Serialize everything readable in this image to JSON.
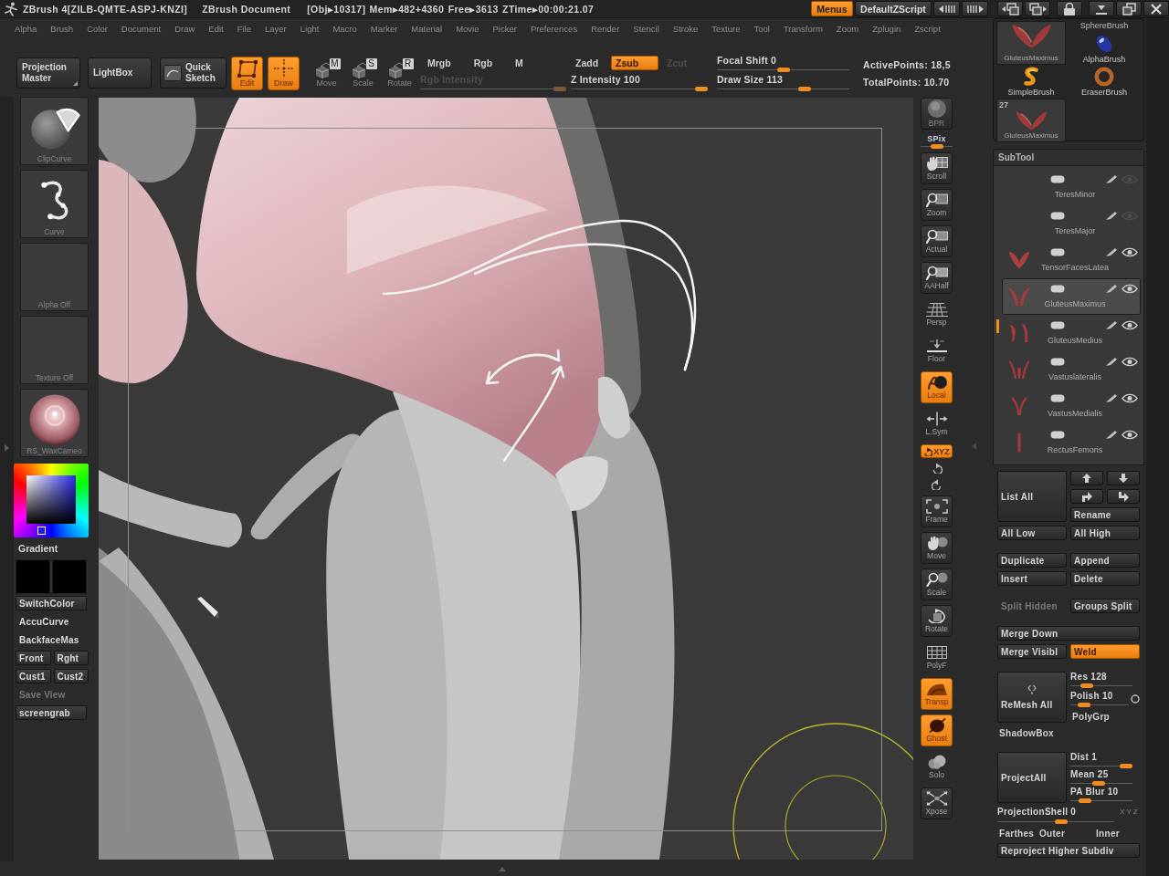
{
  "title_bar": {
    "app_title": "ZBrush 4[ZILB-QMTE-ASPJ-KNZI]",
    "document_title": "ZBrush Document",
    "stats": "[Obj▸10317] Mem▸482+4360 Free▸3613 ZTime▸00:00:21.07",
    "buttons": [
      {
        "label": "Menus",
        "on": true
      },
      {
        "label": "DefaultZScript",
        "on": false
      }
    ]
  },
  "menu_bar": [
    "Alpha",
    "Brush",
    "Color",
    "Document",
    "Draw",
    "Edit",
    "File",
    "Layer",
    "Light",
    "Macro",
    "Marker",
    "Material",
    "Movie",
    "Picker",
    "Preferences",
    "Render",
    "Stencil",
    "Stroke",
    "Texture",
    "Tool",
    "Transform",
    "Zoom",
    "Zplugin",
    "Zscript"
  ],
  "top_shelf": {
    "buttons": [
      {
        "label": "Projection Master"
      },
      {
        "label": "LightBox"
      },
      {
        "label": "Quick Sketch"
      }
    ],
    "modes": [
      {
        "label": "Edit",
        "on": true
      },
      {
        "label": "Draw",
        "on": true
      },
      {
        "label": "Move",
        "key": "M",
        "on": false
      },
      {
        "label": "Scale",
        "key": "S",
        "on": false
      },
      {
        "label": "Rotate",
        "key": "R",
        "on": false
      }
    ],
    "channels": [
      {
        "label": "Mrgb",
        "on": false
      },
      {
        "label": "Rgb",
        "on": false
      },
      {
        "label": "M",
        "on": false
      }
    ],
    "rgb_intensity": {
      "label": "Rgb Intensity",
      "disabled": true,
      "level": 1
    },
    "z_modes": [
      {
        "label": "Zadd",
        "on": false,
        "disabled": false
      },
      {
        "label": "Zsub",
        "on": true,
        "disabled": false
      },
      {
        "label": "Zcut",
        "on": false,
        "disabled": true
      }
    ],
    "z_intensity": {
      "label": "Z Intensity 100",
      "level": 1
    },
    "focal_shift": {
      "label": "Focal Shift 0",
      "level": 0.5
    },
    "draw_size": {
      "label": "Draw Size 113",
      "level": 0.68
    },
    "active_points": "ActivePoints: 18,5",
    "total_points": "TotalPoints: 10.70"
  },
  "left_shelf": {
    "slots": [
      {
        "label": "ClipCurve"
      },
      {
        "label": "Curve"
      },
      {
        "label": "Alpha Off"
      },
      {
        "label": "Texture Off"
      },
      {
        "label": "RS_WaxCameo"
      }
    ],
    "gradient_label": "Gradient",
    "swatches": [
      {
        "color": "#000000"
      },
      {
        "color": "#000000"
      }
    ],
    "controls": [
      [
        {
          "label": "SwitchColor",
          "kind": "button",
          "on": false,
          "disabled": false
        }
      ],
      [
        {
          "label": "AccuCurve",
          "kind": "switch",
          "on": false,
          "disabled": false
        }
      ],
      [
        {
          "label": "BackfaceMas",
          "kind": "switch",
          "on": false,
          "disabled": false
        }
      ],
      [
        {
          "label": "Front",
          "kind": "button",
          "on": false,
          "disabled": false
        },
        {
          "label": "Rght",
          "kind": "button",
          "on": false,
          "disabled": false
        }
      ],
      [
        {
          "label": "Cust1",
          "kind": "button",
          "on": false,
          "disabled": false
        },
        {
          "label": "Cust2",
          "kind": "button",
          "on": false,
          "disabled": false
        }
      ],
      [
        {
          "label": "Save View",
          "kind": "button",
          "on": false,
          "disabled": true
        }
      ],
      [
        {
          "label": "screengrab",
          "kind": "button",
          "on": false,
          "disabled": false
        }
      ]
    ]
  },
  "right_toolbar": [
    {
      "kind": "button",
      "label": "BPR",
      "on": false,
      "disabled": true
    },
    {
      "kind": "slider",
      "label": "SPix",
      "level": 0.5
    },
    {
      "kind": "button",
      "label": "Scroll",
      "on": false,
      "disabled": false
    },
    {
      "kind": "button",
      "label": "Zoom",
      "on": false,
      "disabled": false
    },
    {
      "kind": "button",
      "label": "Actual",
      "on": false,
      "disabled": false
    },
    {
      "kind": "button",
      "label": "AAHalf",
      "on": false,
      "disabled": false
    },
    {
      "kind": "switch",
      "label": "Persp",
      "on": false,
      "disabled": false
    },
    {
      "kind": "switch",
      "label": "Floor",
      "on": false,
      "disabled": false
    },
    {
      "kind": "switch",
      "label": "Local",
      "on": true,
      "disabled": false
    },
    {
      "kind": "switch",
      "label": "L.Sym",
      "on": false,
      "disabled": false
    },
    {
      "kind": "strip",
      "label": "XYZ",
      "on": true,
      "disabled": false
    },
    {
      "kind": "icon",
      "on": false,
      "disabled": false
    },
    {
      "kind": "icon",
      "on": false,
      "disabled": false
    },
    {
      "kind": "button",
      "label": "Frame",
      "on": false,
      "disabled": false
    },
    {
      "kind": "button",
      "label": "Move",
      "on": false,
      "disabled": false
    },
    {
      "kind": "button",
      "label": "Scale",
      "on": false,
      "disabled": false
    },
    {
      "kind": "button",
      "label": "Rotate",
      "on": false,
      "disabled": false
    },
    {
      "kind": "switch",
      "label": "PolyF",
      "on": false,
      "disabled": false
    },
    {
      "kind": "switch",
      "label": "Transp",
      "on": true,
      "disabled": false
    },
    {
      "kind": "switch",
      "label": "Ghost",
      "on": true,
      "disabled": false
    },
    {
      "kind": "switch",
      "label": "Solo",
      "on": false,
      "disabled": false
    },
    {
      "kind": "button",
      "label": "Xpose",
      "on": false,
      "disabled": false
    }
  ],
  "right_panel": {
    "brush_tray": [
      {
        "kind": "caption",
        "label": "SphereBrush"
      },
      {
        "kind": "tool",
        "label": "GluteusMaximus"
      },
      {
        "kind": "brush",
        "label": "AlphaBrush"
      },
      {
        "kind": "brush",
        "label": "SimpleBrush"
      },
      {
        "kind": "brush",
        "label": "EraserBrush"
      },
      {
        "kind": "tool",
        "label": "GluteusMaximus",
        "count": "27"
      }
    ],
    "subtool": {
      "header": "SubTool",
      "slots": [
        {
          "name": "TeresMinor",
          "visible": false,
          "selected": false
        },
        {
          "name": "TeresMajor",
          "visible": false,
          "selected": false
        },
        {
          "name": "TensorFacesLatea",
          "visible": true,
          "selected": false
        },
        {
          "name": "GluteusMaximus",
          "visible": true,
          "selected": true
        },
        {
          "name": "GluteusMedius",
          "visible": true,
          "selected": false
        },
        {
          "name": "Vastuslateralis",
          "visible": true,
          "selected": false
        },
        {
          "name": "VastusMedialis",
          "visible": true,
          "selected": false
        },
        {
          "name": "RectusFemoris",
          "visible": true,
          "selected": false
        }
      ],
      "list_all": "List All",
      "rename": "Rename",
      "button_groups": [
        [
          [
            {
              "label": "All Low",
              "on": false,
              "disabled": false
            },
            {
              "label": "All High",
              "on": false,
              "disabled": false
            }
          ]
        ],
        [
          [
            {
              "label": "Duplicate",
              "on": false,
              "disabled": false
            },
            {
              "label": "Append",
              "on": false,
              "disabled": false
            }
          ],
          [
            {
              "label": "Insert",
              "on": false,
              "disabled": false
            },
            {
              "label": "Delete",
              "on": false,
              "disabled": false
            }
          ]
        ],
        [
          [
            {
              "label": "Split Hidden",
              "on": false,
              "disabled": true
            },
            {
              "label": "Groups Split",
              "on": false,
              "disabled": false
            }
          ]
        ],
        [
          [
            {
              "label": "Merge Down",
              "on": false,
              "disabled": false
            }
          ],
          [
            {
              "label": "Merge Visibl",
              "on": false,
              "disabled": false
            },
            {
              "label": "Weld",
              "on": true,
              "disabled": false
            }
          ]
        ]
      ],
      "remesh": {
        "button": "ReMesh All",
        "sliders": [
          {
            "label": "Res 128",
            "level": 0.2
          },
          {
            "label": "Polish 10",
            "level": 0.15
          }
        ],
        "polygrp": {
          "label": "PolyGrp",
          "on": false
        }
      },
      "shadowbox": {
        "label": "ShadowBox",
        "on": false
      },
      "project": {
        "button": "ProjectAll",
        "sliders": [
          {
            "label": "Dist 1",
            "level": 1
          },
          {
            "label": "Mean 25",
            "level": 0.45
          },
          {
            "label": "PA Blur 10",
            "level": 0.17
          }
        ]
      },
      "projection_shell": {
        "label": "ProjectionShell 0",
        "level": 0.55,
        "axes": "X Y Z"
      },
      "shell_modes": [
        {
          "label": "Farthes",
          "on": false
        },
        {
          "label": "Outer",
          "on": false
        },
        {
          "label": "Inner",
          "on": false
        }
      ],
      "reproject": "Reproject Higher Subdiv"
    }
  }
}
